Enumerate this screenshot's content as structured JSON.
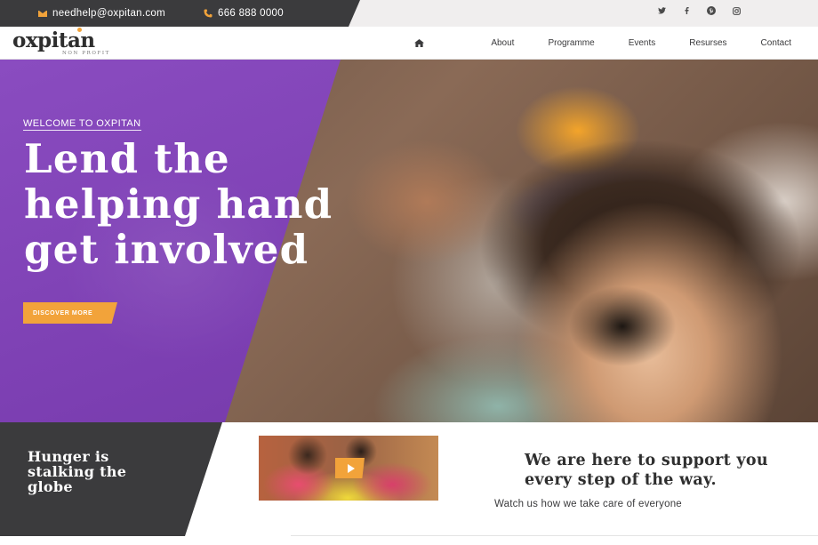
{
  "topbar": {
    "email": "needhelp@oxpitan.com",
    "phone": "666 888 0000",
    "socials": [
      {
        "icon": "twitter-icon",
        "glyph": "🐦"
      },
      {
        "icon": "facebook-icon",
        "glyph": "f"
      },
      {
        "icon": "pinterest-icon",
        "glyph": "P"
      },
      {
        "icon": "instagram-icon",
        "glyph": "◎"
      }
    ]
  },
  "header": {
    "logo_name": "oxpitan",
    "logo_tagline": "NON PROFIT",
    "nav": {
      "home_icon": "home-icon",
      "items": [
        "About",
        "Programme",
        "Events",
        "Resurses",
        "Contact"
      ]
    }
  },
  "hero": {
    "welcome": "WELCOME TO OXPITAN",
    "headline": [
      "Lend the",
      "helping hand",
      "get involved"
    ],
    "cta": "DISCOVER MORE"
  },
  "bottom": {
    "hunger": [
      "Hunger is",
      "stalking the",
      "globe"
    ],
    "support": [
      "We are here to support you",
      "every step of the way."
    ],
    "watch": "Watch us how we take care of everyone"
  },
  "colors": {
    "accent": "#f2a33a",
    "purple": "#7c3fb2",
    "dark": "#3b3b3d"
  }
}
